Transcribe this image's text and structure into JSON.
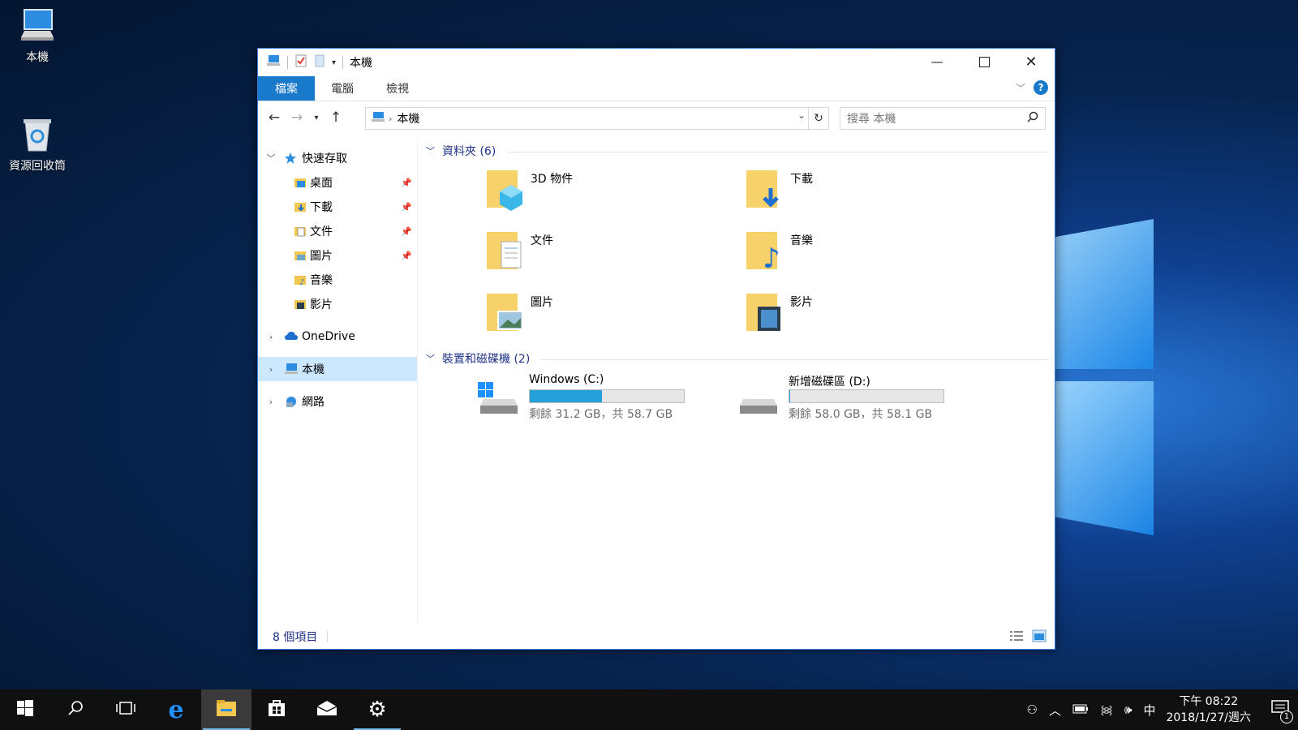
{
  "desktop": {
    "icons": [
      {
        "label": "本機"
      },
      {
        "label": "資源回收筒"
      }
    ]
  },
  "window": {
    "title": "本機",
    "ribbon_tabs": [
      {
        "label": "檔案"
      },
      {
        "label": "電腦"
      },
      {
        "label": "檢視"
      }
    ],
    "help_label": "?",
    "address": {
      "path": "本機"
    },
    "search": {
      "placeholder": "搜尋 本機"
    },
    "nav": {
      "quick_access": "快速存取",
      "quick_items": [
        {
          "label": "桌面",
          "pinned": true
        },
        {
          "label": "下載",
          "pinned": true
        },
        {
          "label": "文件",
          "pinned": true
        },
        {
          "label": "圖片",
          "pinned": true
        },
        {
          "label": "音樂",
          "pinned": false
        },
        {
          "label": "影片",
          "pinned": false
        }
      ],
      "onedrive": "OneDrive",
      "this_pc": "本機",
      "network": "網路"
    },
    "folders_header": "資料夾 (6)",
    "folders": [
      {
        "name": "3D 物件",
        "icon": "3d-objects-folder-icon"
      },
      {
        "name": "下載",
        "icon": "downloads-folder-icon"
      },
      {
        "name": "文件",
        "icon": "documents-folder-icon"
      },
      {
        "name": "音樂",
        "icon": "music-folder-icon"
      },
      {
        "name": "圖片",
        "icon": "pictures-folder-icon"
      },
      {
        "name": "影片",
        "icon": "videos-folder-icon"
      }
    ],
    "drives_header": "裝置和磁碟機 (2)",
    "drives": [
      {
        "name": "Windows (C:)",
        "info": "剩餘 31.2 GB，共 58.7 GB",
        "used_fraction": 0.468
      },
      {
        "name": "新增磁碟區 (D:)",
        "info": "剩餘 58.0 GB，共 58.1 GB",
        "used_fraction": 0.002
      }
    ],
    "status": {
      "count": "8 個項目"
    }
  },
  "taskbar": {
    "clock": {
      "time": "下午 08:22",
      "date": "2018/1/27/週六"
    },
    "ime": "中",
    "notification_count": "1"
  },
  "colors": {
    "accent": "#1979ca",
    "selection": "#cce8ff",
    "drive_bar": "#26a0da",
    "group_header": "#1e3287"
  }
}
